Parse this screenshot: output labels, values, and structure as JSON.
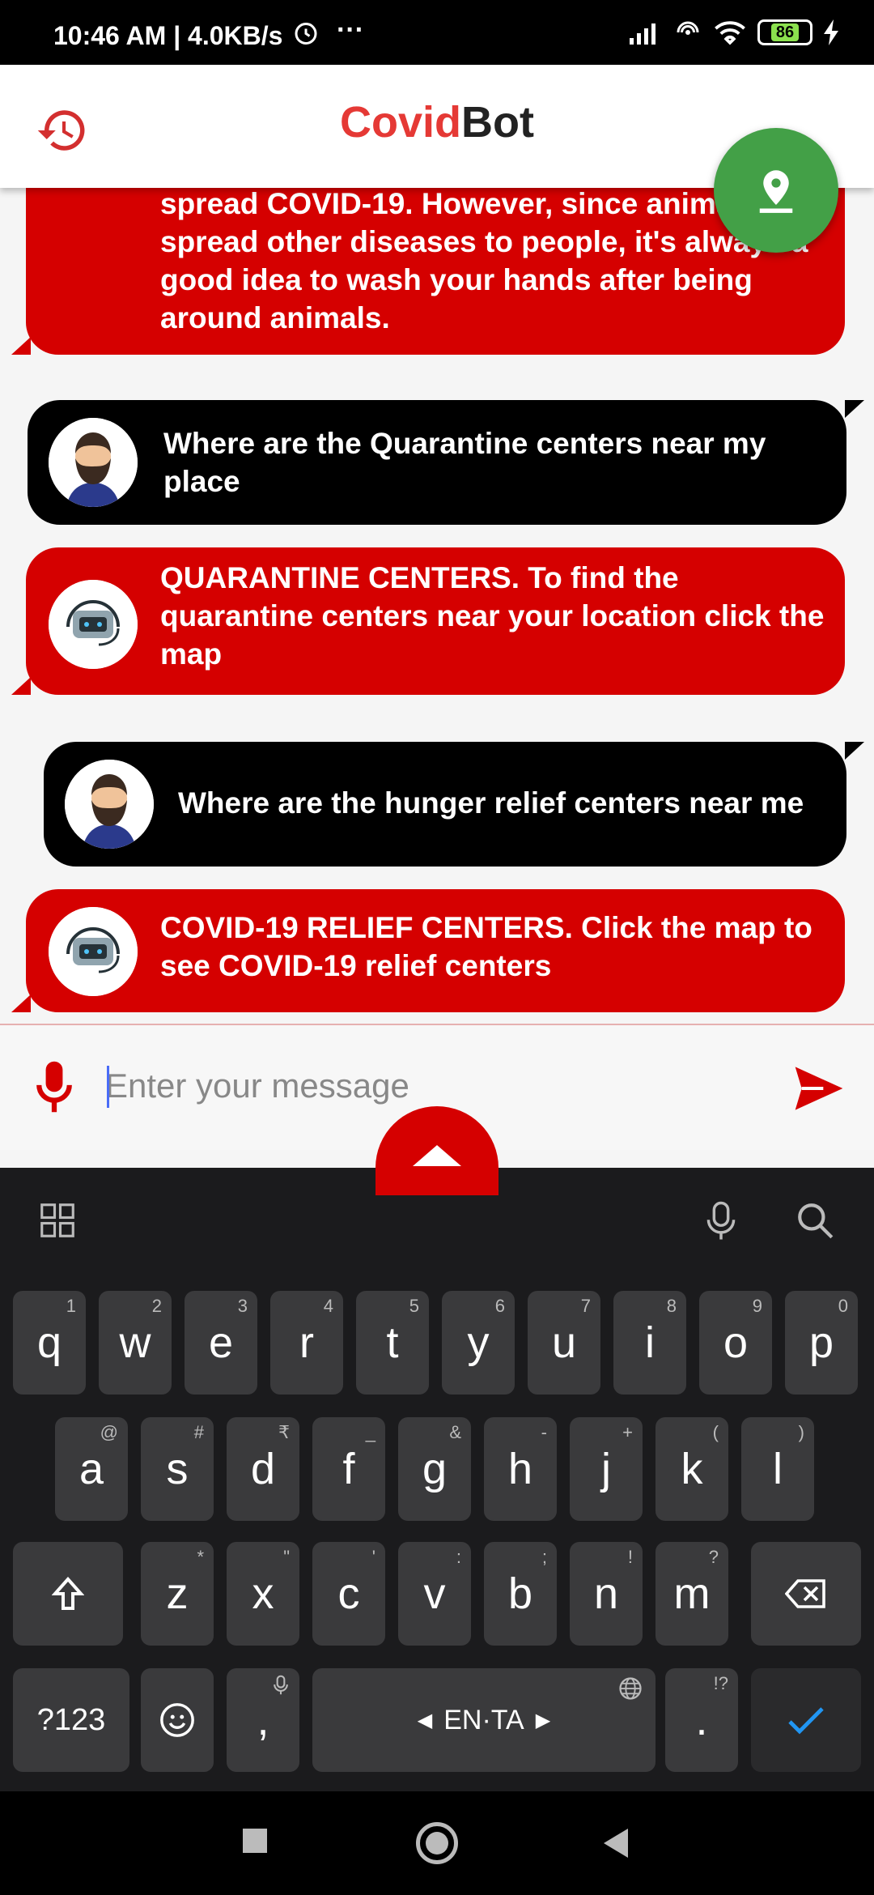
{
  "status_bar": {
    "time": "10:46 AM | 4.0KB/s",
    "battery": "86"
  },
  "app_bar": {
    "title_part1": "Covid",
    "title_part2": "Bot"
  },
  "messages": [
    {
      "from": "bot",
      "text": "spread COVID-19. However, since animals can spread other diseases to people, it's always a good idea to wash your hands after being around animals."
    },
    {
      "from": "user",
      "text": "Where are the Quarantine centers near my place"
    },
    {
      "from": "bot",
      "text": "QUARANTINE CENTERS.   To find the quarantine centers near your location click the map"
    },
    {
      "from": "user",
      "text": "Where are the hunger relief centers near me"
    },
    {
      "from": "bot",
      "text": "COVID-19 RELIEF CENTERS. Click the map to see COVID-19 relief centers"
    }
  ],
  "input": {
    "placeholder": "Enter your message"
  },
  "keyboard": {
    "row1": [
      {
        "k": "q",
        "s": "1"
      },
      {
        "k": "w",
        "s": "2"
      },
      {
        "k": "e",
        "s": "3"
      },
      {
        "k": "r",
        "s": "4"
      },
      {
        "k": "t",
        "s": "5"
      },
      {
        "k": "y",
        "s": "6"
      },
      {
        "k": "u",
        "s": "7"
      },
      {
        "k": "i",
        "s": "8"
      },
      {
        "k": "o",
        "s": "9"
      },
      {
        "k": "p",
        "s": "0"
      }
    ],
    "row2": [
      {
        "k": "a",
        "s": "@"
      },
      {
        "k": "s",
        "s": "#"
      },
      {
        "k": "d",
        "s": "₹"
      },
      {
        "k": "f",
        "s": "_"
      },
      {
        "k": "g",
        "s": "&"
      },
      {
        "k": "h",
        "s": "-"
      },
      {
        "k": "j",
        "s": "+"
      },
      {
        "k": "k",
        "s": "("
      },
      {
        "k": "l",
        "s": ")"
      }
    ],
    "row3": [
      {
        "k": "z",
        "s": "*"
      },
      {
        "k": "x",
        "s": "\""
      },
      {
        "k": "c",
        "s": "'"
      },
      {
        "k": "v",
        "s": ":"
      },
      {
        "k": "b",
        "s": ";"
      },
      {
        "k": "n",
        "s": "!"
      },
      {
        "k": "m",
        "s": "?"
      }
    ],
    "symbols_label": "?123",
    "comma": ",",
    "space_label": "EN·TA",
    "period": ".",
    "period_sup": "!?"
  },
  "colors": {
    "accent_red": "#d50000",
    "fab_green": "#43a047",
    "user_bubble": "#000000"
  }
}
